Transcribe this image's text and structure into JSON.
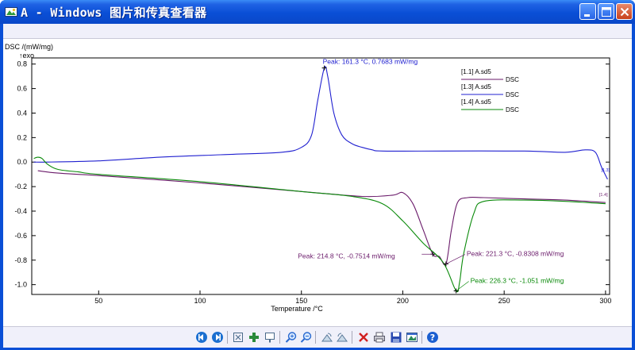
{
  "window": {
    "title": "A - Windows 图片和传真查看器",
    "title_icon": "picture-viewer-icon"
  },
  "titlebar_buttons": [
    "minimize-icon",
    "maximize-icon",
    "close-icon"
  ],
  "chart_data": {
    "type": "line",
    "ylabel": "DSC /(mW/mg)",
    "exo_label": "↑exo",
    "xlabel": "Temperature /°C",
    "xlim": [
      17,
      302
    ],
    "ylim": [
      -1.08,
      0.85
    ],
    "x_ticks": [
      50,
      100,
      150,
      200,
      250,
      300
    ],
    "y_ticks": [
      0.8,
      0.6,
      0.4,
      0.2,
      0.0,
      -0.2,
      -0.4,
      -0.6,
      -0.8,
      -1.0
    ],
    "y_tick_labels": [
      "0.8",
      "0.6",
      "0.4",
      "0.2",
      "0.0",
      "-0.2",
      "-0.4",
      "-0.6",
      "-0.8",
      "-1.0"
    ],
    "legend_position": "top-right",
    "series": [
      {
        "name": "[1.1] A.sd5",
        "legend_sub": "DSC",
        "color": "#6a1a6a",
        "x": [
          20,
          30,
          50,
          100,
          150,
          180,
          195,
          200,
          205,
          210,
          214.8,
          218,
          221.3,
          224,
          227,
          232,
          240,
          260,
          280,
          300
        ],
        "y": [
          -0.07,
          -0.09,
          -0.11,
          -0.17,
          -0.24,
          -0.28,
          -0.27,
          -0.25,
          -0.34,
          -0.55,
          -0.7514,
          -0.77,
          -0.8308,
          -0.55,
          -0.33,
          -0.29,
          -0.29,
          -0.3,
          -0.31,
          -0.33
        ]
      },
      {
        "name": "[1.3] A.sd5",
        "legend_sub": "DSC",
        "color": "#2020d0",
        "x": [
          18,
          25,
          50,
          80,
          110,
          140,
          150,
          155,
          158,
          161.3,
          163,
          166,
          170,
          175,
          180,
          185,
          190,
          220,
          260,
          280,
          290,
          295,
          298,
          301
        ],
        "y": [
          0.0,
          0.0,
          0.01,
          0.04,
          0.06,
          0.08,
          0.12,
          0.22,
          0.5,
          0.7683,
          0.7,
          0.4,
          0.22,
          0.15,
          0.12,
          0.1,
          0.09,
          0.09,
          0.09,
          0.08,
          0.1,
          0.08,
          -0.04,
          -0.14
        ]
      },
      {
        "name": "[1.4] A.sd5",
        "legend_sub": "DSC",
        "color": "#0a8a0a",
        "x": [
          18,
          20,
          22,
          25,
          30,
          40,
          50,
          100,
          150,
          175,
          190,
          200,
          210,
          220,
          226.3,
          228,
          230,
          235,
          240,
          260,
          280,
          300
        ],
        "y": [
          0.03,
          0.04,
          0.03,
          -0.02,
          -0.06,
          -0.08,
          -0.1,
          -0.16,
          -0.24,
          -0.28,
          -0.34,
          -0.48,
          -0.66,
          -0.82,
          -1.051,
          -0.98,
          -0.75,
          -0.42,
          -0.32,
          -0.31,
          -0.32,
          -0.34
        ]
      }
    ],
    "annotations": [
      {
        "text": "Peak: 161.3 °C, 0.7683 mW/mg",
        "series": 1,
        "x": 161.3,
        "y": 0.7683
      },
      {
        "text": "Peak: 214.8 °C, -0.7514 mW/mg",
        "series": 0,
        "x": 214.8,
        "y": -0.7514
      },
      {
        "text": "Peak: 221.3 °C, -0.8308 mW/mg",
        "series": 0,
        "x": 221.3,
        "y": -0.8308
      },
      {
        "text": "Peak: 226.3 °C, -1.051 mW/mg",
        "series": 2,
        "x": 226.3,
        "y": -1.051
      }
    ],
    "end_tags": [
      {
        "text": "[1.3]",
        "series": 1
      },
      {
        "text": "[1.4]",
        "series": 0
      }
    ]
  },
  "toolbar": [
    {
      "name": "previous-image-icon",
      "color": "#1c6fd0"
    },
    {
      "name": "next-image-icon",
      "color": "#1c6fd0"
    },
    {
      "name": "best-fit-icon",
      "color": "#4a6a8a"
    },
    {
      "name": "actual-size-icon",
      "color": "#2a8a3a"
    },
    {
      "name": "slideshow-icon",
      "color": "#4a6a8a"
    },
    {
      "name": "zoom-in-icon",
      "color": "#2a6ad0"
    },
    {
      "name": "zoom-out-icon",
      "color": "#2a6ad0"
    },
    {
      "name": "rotate-clockwise-icon",
      "color": "#5a7a9a"
    },
    {
      "name": "rotate-counterclockwise-icon",
      "color": "#5a7a9a"
    },
    {
      "name": "delete-icon",
      "color": "#d02020"
    },
    {
      "name": "print-icon",
      "color": "#5a5a6a"
    },
    {
      "name": "save-copy-icon",
      "color": "#2a4ab0"
    },
    {
      "name": "open-for-editing-icon",
      "color": "#2a8a5a"
    },
    {
      "name": "help-icon",
      "color": "#1c5fd0"
    }
  ]
}
